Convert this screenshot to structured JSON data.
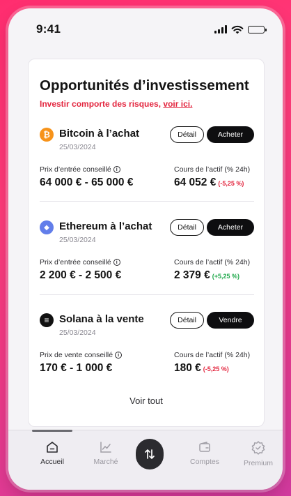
{
  "status_bar": {
    "time": "9:41"
  },
  "card": {
    "title": "Opportunités d’investissement",
    "warning_text": "Investir comporte des risques, ",
    "warning_link": "voir ici."
  },
  "opportunities": [
    {
      "icon": "bitcoin-icon",
      "icon_glyph": "₿",
      "icon_color": "#f7931a",
      "title": "Bitcoin à l’achat",
      "date": "25/03/2024",
      "detail_label": "Détail",
      "action_label": "Acheter",
      "price_label": "Prix d’entrée conseillé",
      "price_value": "64 000 € - 65 000 €",
      "asset_label": "Cours de l’actif (% 24h)",
      "asset_value": "64 052 €",
      "asset_change": "(-5,25 %)",
      "change_color": "#e3263f"
    },
    {
      "icon": "ethereum-icon",
      "icon_glyph": "◆",
      "icon_color": "#627eea",
      "title": "Ethereum à l’achat",
      "date": "25/03/2024",
      "detail_label": "Détail",
      "action_label": "Acheter",
      "price_label": "Prix d’entrée conseillé",
      "price_value": "2 200 € - 2 500 €",
      "asset_label": "Cours de l’actif (% 24h)",
      "asset_value": "2 379 €",
      "asset_change": "(+5,25 %)",
      "change_color": "#1ea84a"
    },
    {
      "icon": "solana-icon",
      "icon_glyph": "≡",
      "icon_color": "#111111",
      "title": "Solana à la vente",
      "date": "25/03/2024",
      "detail_label": "Détail",
      "action_label": "Vendre",
      "price_label": "Prix de vente conseillé",
      "price_value": "170 € - 1 000 €",
      "asset_label": "Cours de l’actif (% 24h)",
      "asset_value": "180 €",
      "asset_change": "(-5,25 %)",
      "change_color": "#e3263f"
    }
  ],
  "see_all_label": "Voir tout",
  "tabs": [
    {
      "label": "Accueil",
      "icon": "home-icon",
      "active": true
    },
    {
      "label": "Marché",
      "icon": "chart-icon",
      "active": false
    },
    {
      "label": "",
      "icon": "swap-arrows-icon",
      "active": false
    },
    {
      "label": "Comptes",
      "icon": "wallet-icon",
      "active": false
    },
    {
      "label": "Premium",
      "icon": "premium-badge-icon",
      "active": false
    }
  ],
  "colors": {
    "accent_red": "#e3263f",
    "positive_green": "#1ea84a",
    "background_gradient": "#ff2d6f",
    "button_dark": "#0e0e10"
  }
}
